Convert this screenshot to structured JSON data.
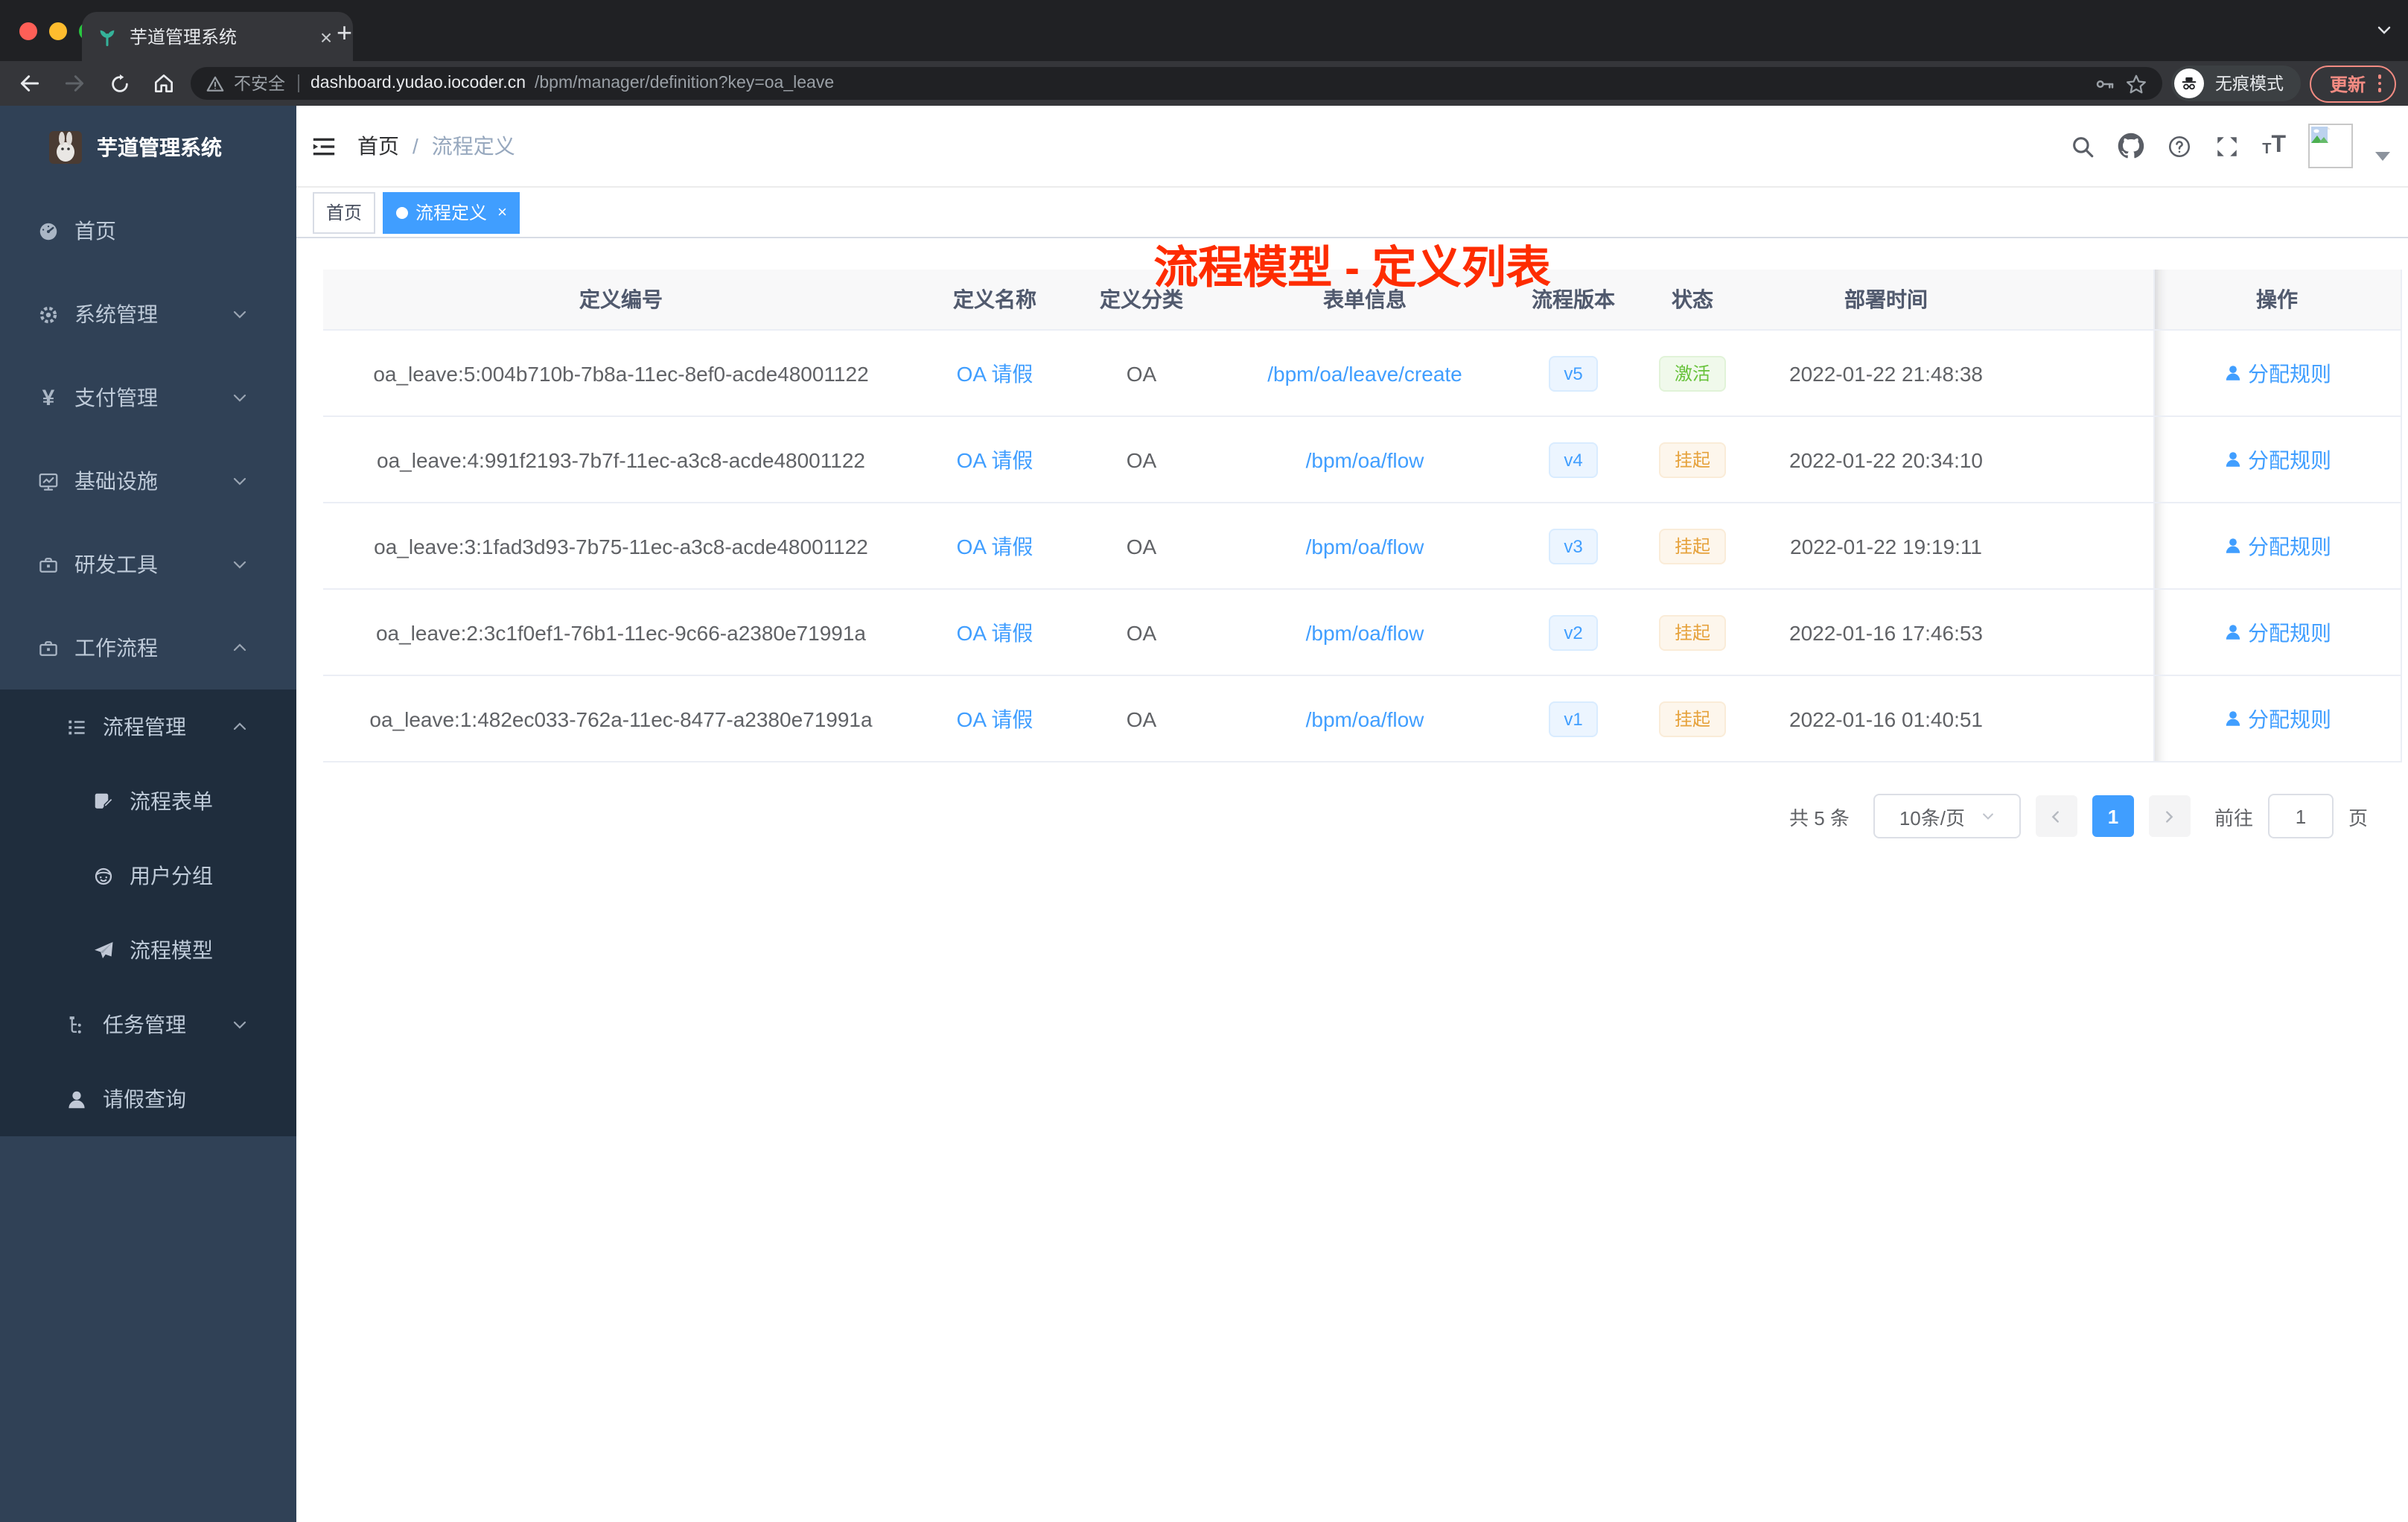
{
  "browser": {
    "tab": {
      "title": "芋道管理系统",
      "close": "×",
      "new_tab": "+"
    },
    "nav": {
      "security_label": "不安全",
      "url_host": "dashboard.yudao.iocoder.cn",
      "url_path": "/bpm/manager/definition?key=oa_leave"
    },
    "incognito_label": "无痕模式",
    "update_button": "更新"
  },
  "sidebar": {
    "logo_title": "芋道管理系统",
    "items": [
      {
        "label": "首页",
        "icon": "dashboard-icon"
      },
      {
        "label": "系统管理",
        "icon": "gear-icon"
      },
      {
        "label": "支付管理",
        "icon": "yen-icon"
      },
      {
        "label": "基础设施",
        "icon": "monitor-icon"
      },
      {
        "label": "研发工具",
        "icon": "toolbox-icon"
      },
      {
        "label": "工作流程",
        "icon": "briefcase-icon"
      },
      {
        "label": "流程管理",
        "icon": "list-tree-icon"
      },
      {
        "label": "流程表单",
        "icon": "form-icon"
      },
      {
        "label": "用户分组",
        "icon": "user-group-icon"
      },
      {
        "label": "流程模型",
        "icon": "paper-plane-icon"
      },
      {
        "label": "任务管理",
        "icon": "task-tree-icon"
      },
      {
        "label": "请假查询",
        "icon": "user-icon"
      }
    ],
    "yen_glyph": "¥"
  },
  "header": {
    "breadcrumb": {
      "home": "首页",
      "separator": "/",
      "current": "流程定义"
    },
    "overlay_title": "流程模型 - 定义列表"
  },
  "tags": {
    "home": "首页",
    "active": "流程定义",
    "close": "×"
  },
  "table": {
    "columns": [
      "定义编号",
      "定义名称",
      "定义分类",
      "表单信息",
      "流程版本",
      "状态",
      "部署时间",
      "操作"
    ],
    "action_label": "分配规则",
    "rows": [
      {
        "id": "oa_leave:5:004b710b-7b8a-11ec-8ef0-acde48001122",
        "name": "OA 请假",
        "category": "OA",
        "form": "/bpm/oa/leave/create",
        "version": "v5",
        "status": "激活",
        "time": "2022-01-22 21:48:38"
      },
      {
        "id": "oa_leave:4:991f2193-7b7f-11ec-a3c8-acde48001122",
        "name": "OA 请假",
        "category": "OA",
        "form": "/bpm/oa/flow",
        "version": "v4",
        "status": "挂起",
        "time": "2022-01-22 20:34:10"
      },
      {
        "id": "oa_leave:3:1fad3d93-7b75-11ec-a3c8-acde48001122",
        "name": "OA 请假",
        "category": "OA",
        "form": "/bpm/oa/flow",
        "version": "v3",
        "status": "挂起",
        "time": "2022-01-22 19:19:11"
      },
      {
        "id": "oa_leave:2:3c1f0ef1-76b1-11ec-9c66-a2380e71991a",
        "name": "OA 请假",
        "category": "OA",
        "form": "/bpm/oa/flow",
        "version": "v2",
        "status": "挂起",
        "time": "2022-01-16 17:46:53"
      },
      {
        "id": "oa_leave:1:482ec033-762a-11ec-8477-a2380e71991a",
        "name": "OA 请假",
        "category": "OA",
        "form": "/bpm/oa/flow",
        "version": "v1",
        "status": "挂起",
        "time": "2022-01-16 01:40:51"
      }
    ]
  },
  "pagination": {
    "total": "共 5 条",
    "page_size": "10条/页",
    "prev": "‹",
    "page": "1",
    "next": "›",
    "goto_label": "前往",
    "goto_value": "1",
    "unit": "页"
  },
  "colors": {
    "accent": "#409eff",
    "title_red": "#fe2c00",
    "success": "#67c23a",
    "warning": "#e6a23c",
    "sidebar_bg": "#304156",
    "submenu_bg": "#1f2d3d",
    "active_tag": "#409eff"
  }
}
